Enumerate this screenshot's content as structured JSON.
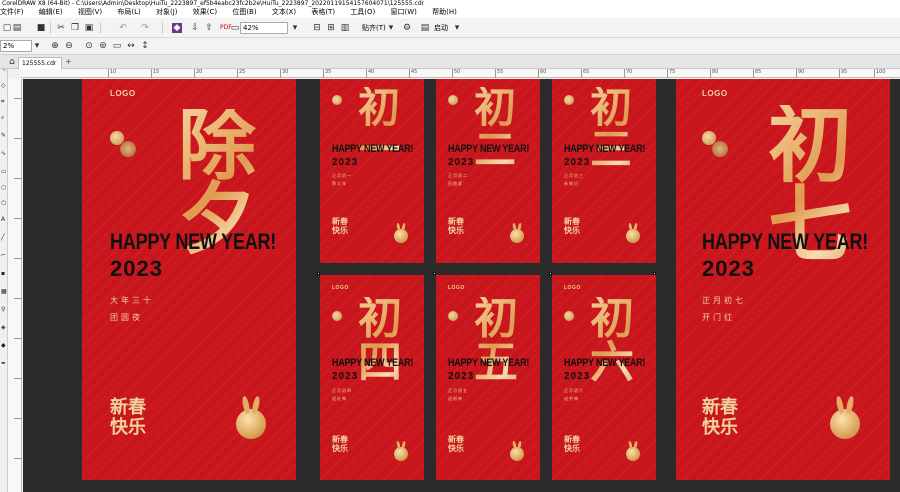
{
  "window": {
    "title": "CorelDRAW X8 (64-Bit) - C:\\Users\\Admin\\Desktop\\HuiTu_2223897_ef5b4eabc23fc2b2e\\HuiTu_2223897_20220119154157604071\\125555.cdr"
  },
  "menu": [
    "文件(F)",
    "编辑(E)",
    "视图(V)",
    "布局(L)",
    "对象(J)",
    "效果(C)",
    "位图(B)",
    "文本(X)",
    "表格(T)",
    "工具(O)",
    "窗口(W)",
    "帮助(H)"
  ],
  "toolbar": {
    "zoom": "42%",
    "snap_label": "贴齐(T)",
    "launch_label": "启动",
    "zoom_small": "2%"
  },
  "tab": {
    "filename": "125555.cdr"
  },
  "ruler_labels": [
    "10",
    "15",
    "20",
    "25",
    "30",
    "35",
    "40",
    "45",
    "50",
    "55",
    "60",
    "65",
    "70",
    "75",
    "80",
    "85",
    "90",
    "95",
    "100"
  ],
  "posters": {
    "logo": "LOGO",
    "hny": "HAPPY NEW YEAR!",
    "year": "2023",
    "xinchun_top": "新春",
    "xinchun_bottom": "快乐",
    "left": {
      "big": "除夕",
      "sub1": "大年三十",
      "sub2": "团圆夜"
    },
    "right": {
      "big": "初七",
      "sub1": "正月初七",
      "sub2": "开门红"
    },
    "p1": {
      "big": "初一",
      "sub1": "正月初一",
      "sub2": "拜大年"
    },
    "p2": {
      "big": "初二",
      "sub1": "正月初二",
      "sub2": "回娘家"
    },
    "p3": {
      "big": "初三",
      "sub1": "正月初三",
      "sub2": "赤狗日"
    },
    "p4": {
      "big": "初四",
      "sub1": "正月初四",
      "sub2": "迎灶神"
    },
    "p5": {
      "big": "初五",
      "sub1": "正月初五",
      "sub2": "迎财神"
    },
    "p6": {
      "big": "初六",
      "sub1": "正月初六",
      "sub2": "送穷神"
    }
  },
  "colors": {
    "poster_red": "#c9151c",
    "gold": "#f1d29c",
    "canvas": "#2b2b2b"
  }
}
